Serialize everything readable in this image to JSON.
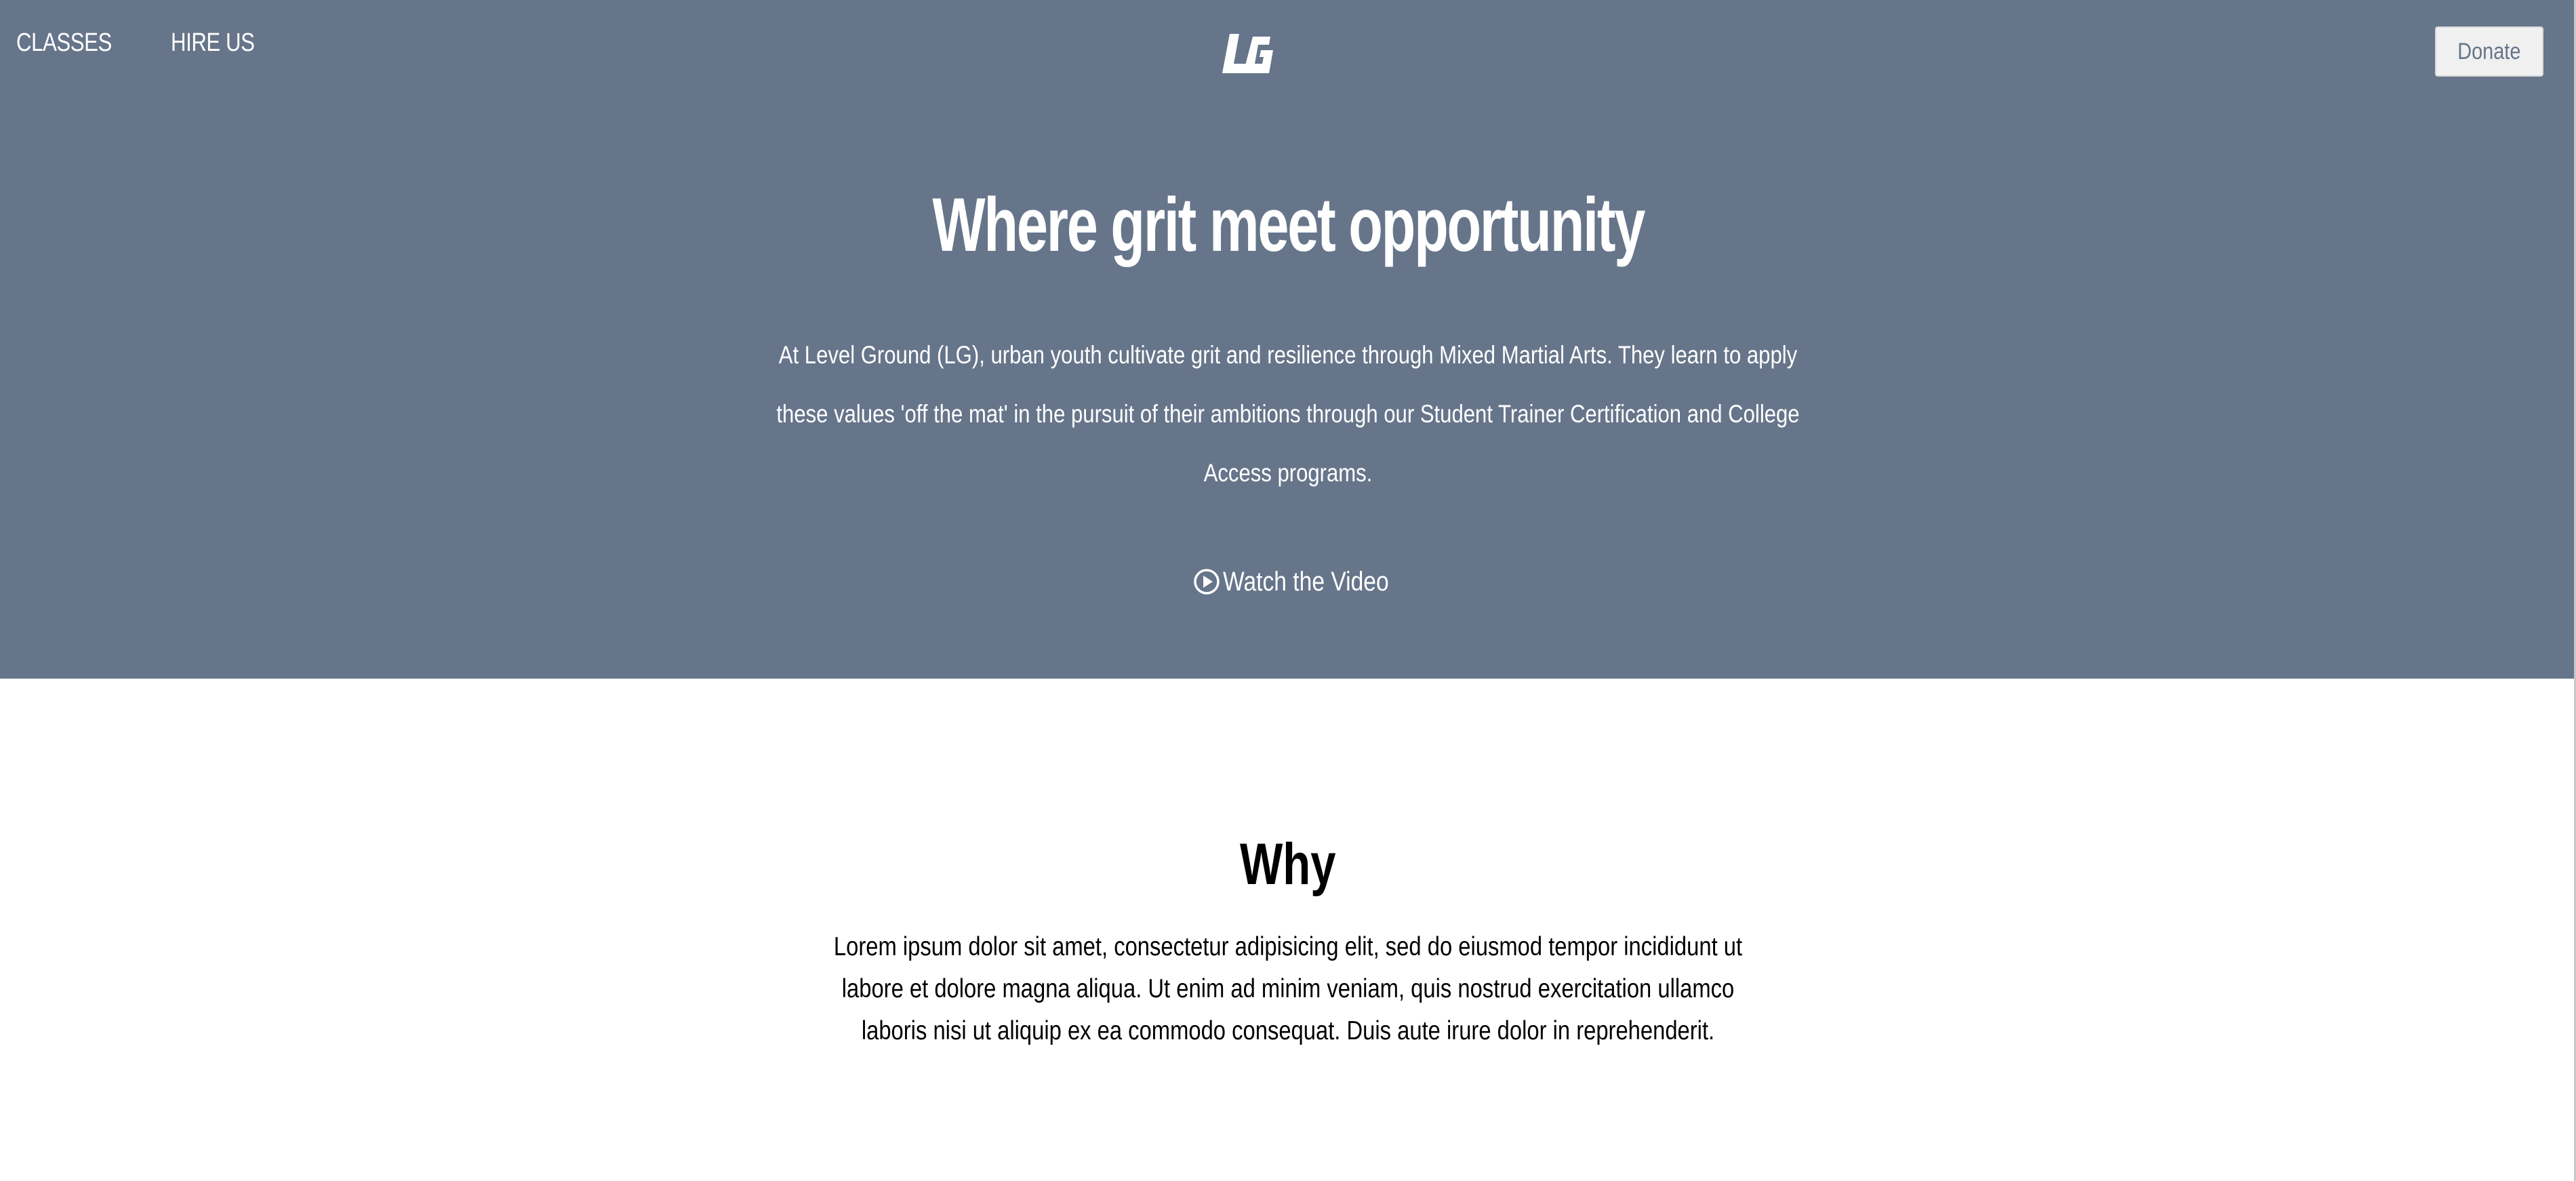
{
  "nav": {
    "links": [
      {
        "label": "CLASSES"
      },
      {
        "label": "HIRE US"
      }
    ],
    "logo_icon": "lg-logo-icon",
    "donate_label": "Donate"
  },
  "hero": {
    "title": "Where grit meet opportunity",
    "body": "At Level Ground (LG), urban youth cultivate grit and resilience through Mixed Martial Arts. They learn to apply these values 'off the mat' in the pursuit of their ambitions through our Student Trainer Certification and College Access programs.",
    "video_label": "Watch the Video",
    "video_icon": "play-circle-icon"
  },
  "why": {
    "title": "Why",
    "body": "Lorem ipsum dolor sit amet, consectetur adipisicing elit, sed do eiusmod tempor incididunt ut labore et dolore magna aliqua. Ut enim ad minim veniam, quis nostrud exercitation ullamco laboris nisi ut aliquip ex ea commodo consequat. Duis aute irure dolor in reprehenderit."
  },
  "colors": {
    "hero_bg": "#66758a",
    "text_light": "#ffffff",
    "button_bg": "#f0f0f0"
  }
}
